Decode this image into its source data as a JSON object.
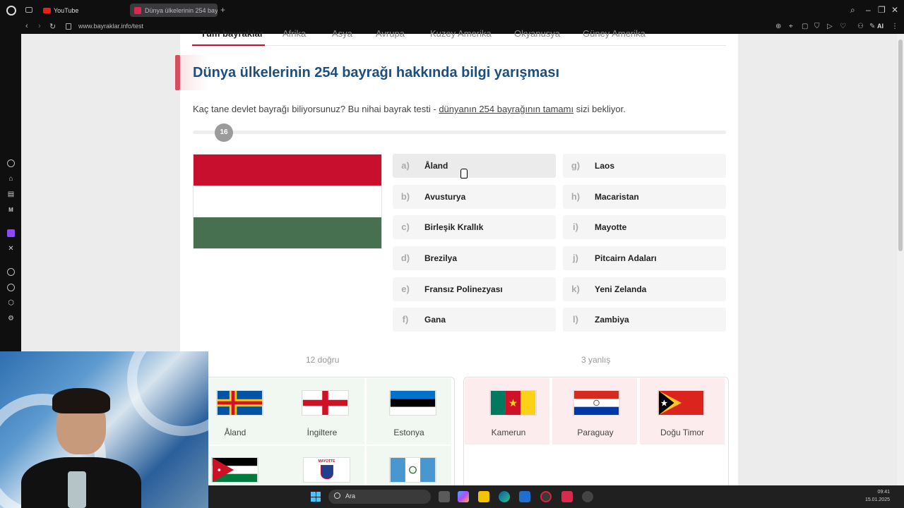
{
  "browser": {
    "tabs": [
      {
        "label": "YouTube"
      },
      {
        "label": "Dünya ülkelerinin 254 bay"
      }
    ],
    "new_tab": "+",
    "url": "www.bayraklar.info/test",
    "ai_label": "AI"
  },
  "page": {
    "region_tabs": [
      "Tüm bayraklar",
      "Afrika",
      "Asya",
      "Avrupa",
      "Kuzey Amerika",
      "Okyanusya",
      "Güney Amerika"
    ],
    "title": "Dünya ülkelerinin 254 bayrağı hakkında bilgi yarışması",
    "intro_before": "Kaç tane devlet bayrağı biliyorsunuz? Bu nihai bayrak testi - ",
    "intro_link": "dünyanın 254 bayrağının tamamı",
    "intro_after": " sizi bekliyor.",
    "progress_value": "16",
    "options": [
      {
        "letter": "a)",
        "text": "Åland"
      },
      {
        "letter": "b)",
        "text": "Avusturya"
      },
      {
        "letter": "c)",
        "text": "Birleşik Krallık"
      },
      {
        "letter": "d)",
        "text": "Brezilya"
      },
      {
        "letter": "e)",
        "text": "Fransız Polinezyası"
      },
      {
        "letter": "f)",
        "text": "Gana"
      },
      {
        "letter": "g)",
        "text": "Laos"
      },
      {
        "letter": "h)",
        "text": "Macaristan"
      },
      {
        "letter": "i)",
        "text": "Mayotte"
      },
      {
        "letter": "j)",
        "text": "Pitcairn Adaları"
      },
      {
        "letter": "k)",
        "text": "Yeni Zelanda"
      },
      {
        "letter": "l)",
        "text": "Zambiya"
      }
    ],
    "correct_label": "12 doğru",
    "wrong_label": "3 yanlış",
    "correct_flags": [
      {
        "name": "Åland"
      },
      {
        "name": "İngiltere"
      },
      {
        "name": "Estonya"
      }
    ],
    "wrong_flags": [
      {
        "name": "Kamerun"
      },
      {
        "name": "Paraguay"
      },
      {
        "name": "Doğu Timor"
      }
    ],
    "mini_flag_text": "MAYOTTE"
  },
  "taskbar": {
    "search_placeholder": "Ara",
    "time": "09:41",
    "date": "15.01.2025"
  },
  "colors": {
    "title_blue": "#1e4f7c",
    "accent_red": "#c8102e",
    "hungary_red": "#c8102e",
    "hungary_green": "#477050",
    "correct_bg": "#f1f8f1",
    "wrong_bg": "#fdecee"
  }
}
